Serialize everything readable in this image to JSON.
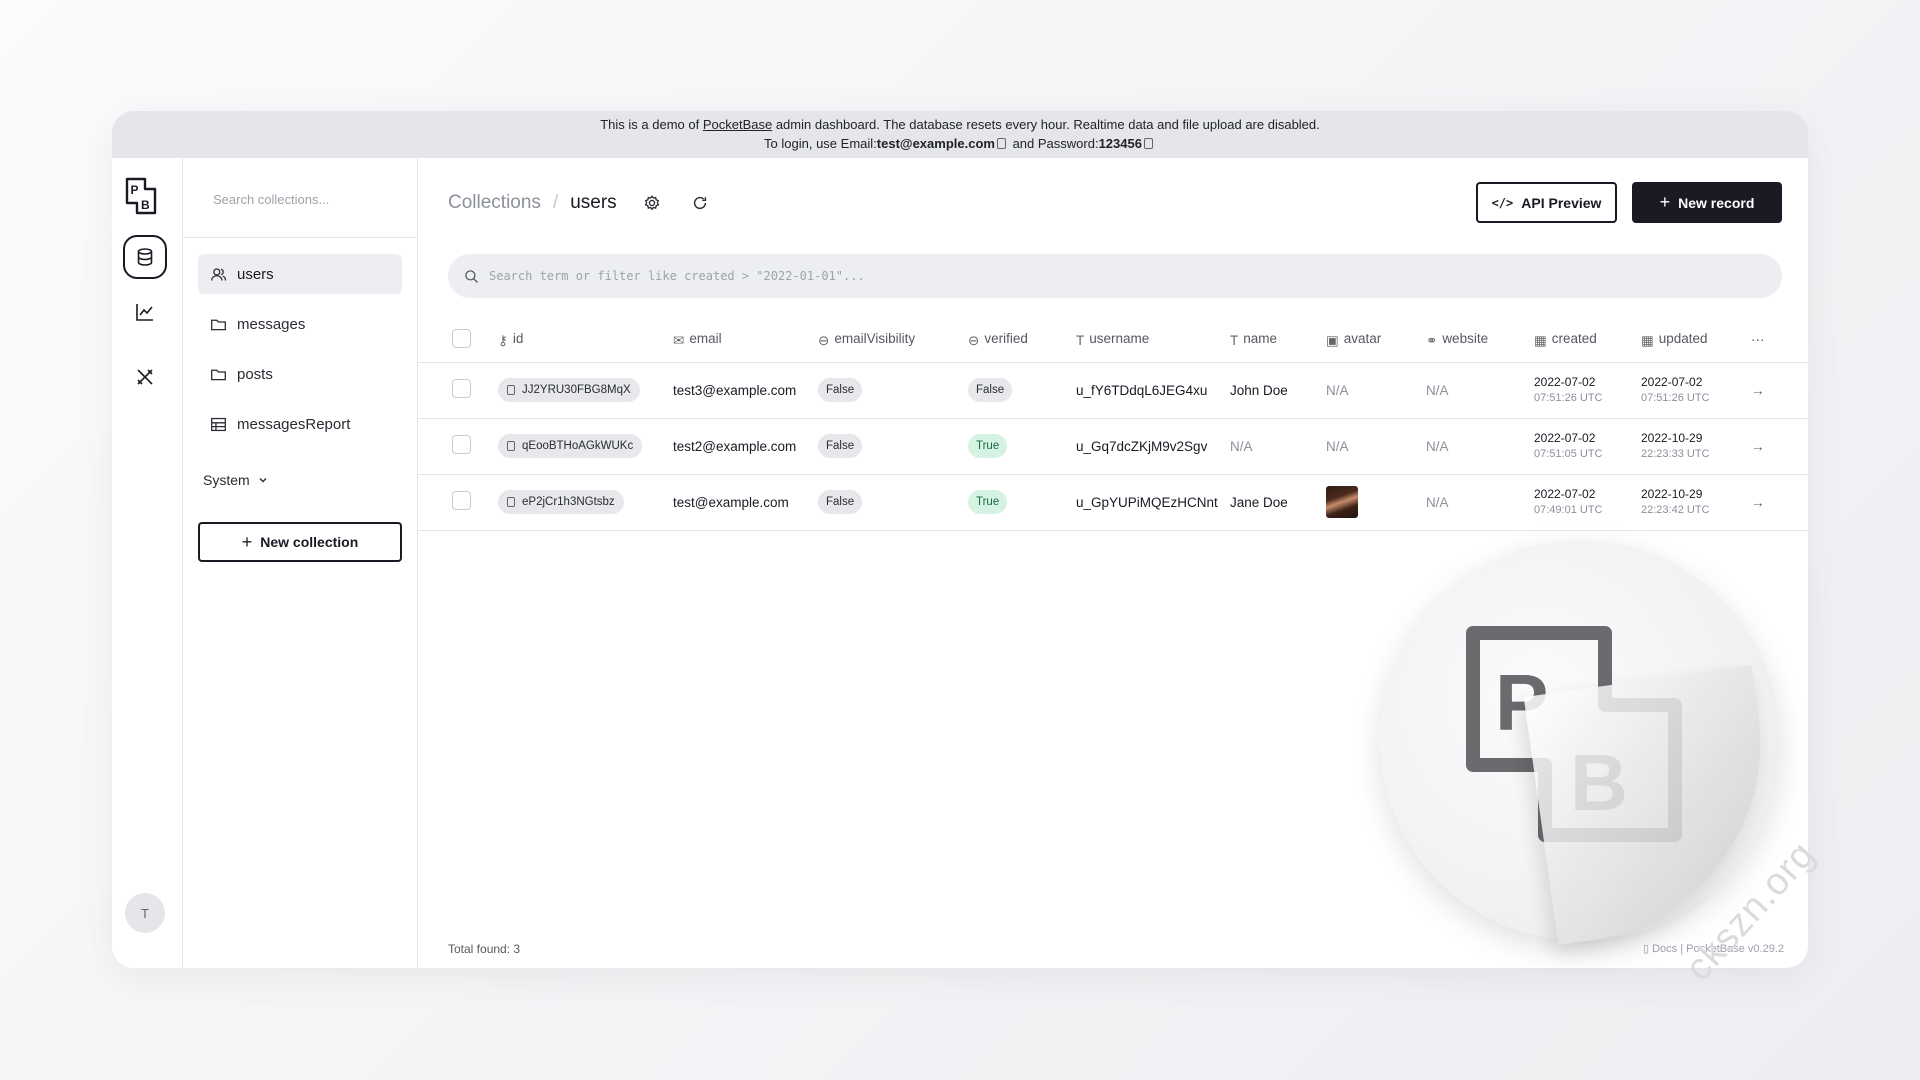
{
  "banner": {
    "line1_pre": "This is a demo of ",
    "line1_link": "PocketBase",
    "line1_post": " admin dashboard. The database resets every hour. Realtime data and file upload are disabled.",
    "line2_pre": "To login, use Email:",
    "line2_email": "test@example.com",
    "line2_mid": " and Password:",
    "line2_password": "123456"
  },
  "rail": {
    "logo": "pb-logo",
    "items": [
      "database-icon",
      "chart-icon",
      "tools-icon"
    ],
    "user_initial": "T"
  },
  "sidebar": {
    "search_placeholder": "Search collections...",
    "collections": [
      {
        "label": "users",
        "icon": "users-icon",
        "active": true
      },
      {
        "label": "messages",
        "icon": "folder-icon",
        "active": false
      },
      {
        "label": "posts",
        "icon": "folder-icon",
        "active": false
      },
      {
        "label": "messagesReport",
        "icon": "table-icon",
        "active": false
      }
    ],
    "system_label": "System",
    "new_collection_label": "New collection"
  },
  "header": {
    "breadcrumb_root": "Collections",
    "breadcrumb_sep": "/",
    "breadcrumb_current": "users",
    "api_preview_label": "API Preview",
    "new_record_label": "New record"
  },
  "filter": {
    "placeholder": "Search term or filter like created > \"2022-01-01\"..."
  },
  "table": {
    "columns": [
      "id",
      "email",
      "emailVisibility",
      "verified",
      "username",
      "name",
      "avatar",
      "website",
      "created",
      "updated"
    ],
    "rows": [
      {
        "id": "JJ2YRU30FBG8MqX",
        "email": "test3@example.com",
        "emailVisibility": "False",
        "verified": "False",
        "username": "u_fY6TDdqL6JEG4xu",
        "name": "John Doe",
        "avatar": "N/A",
        "website": "N/A",
        "created_date": "2022-07-02",
        "created_time": "07:51:26 UTC",
        "updated_date": "2022-07-02",
        "updated_time": "07:51:26 UTC"
      },
      {
        "id": "qEooBTHoAGkWUKc",
        "email": "test2@example.com",
        "emailVisibility": "False",
        "verified": "True",
        "username": "u_Gq7dcZKjM9v2Sgv",
        "name": "N/A",
        "avatar": "N/A",
        "website": "N/A",
        "created_date": "2022-07-02",
        "created_time": "07:51:05 UTC",
        "updated_date": "2022-10-29",
        "updated_time": "22:23:33 UTC"
      },
      {
        "id": "eP2jCr1h3NGtsbz",
        "email": "test@example.com",
        "emailVisibility": "False",
        "verified": "True",
        "username": "u_GpYUPiMQEzHCNnt",
        "name": "Jane Doe",
        "avatar": "image",
        "website": "N/A",
        "created_date": "2022-07-02",
        "created_time": "07:49:01 UTC",
        "updated_date": "2022-10-29",
        "updated_time": "22:23:42 UTC"
      }
    ]
  },
  "footer": {
    "total_label": "Total found:",
    "total_value": "3",
    "docs_label": "Docs",
    "version_label": "PocketBase v0.29.2"
  },
  "watermark": {
    "text": "ckszn.org"
  },
  "colors": {
    "accent": "#1a1a24",
    "true_bg": "#d5f2e2",
    "true_text": "#1e6a43",
    "false_bg": "#e6e8eb"
  }
}
